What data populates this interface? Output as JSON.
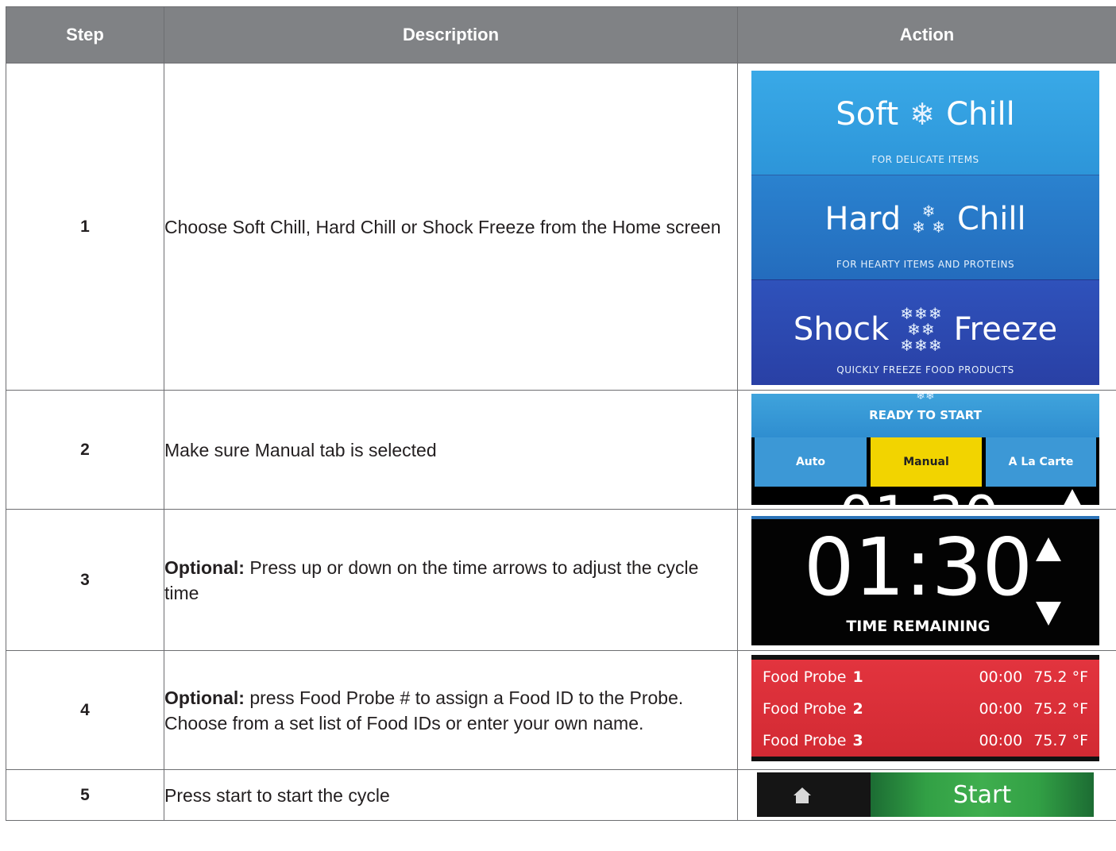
{
  "table": {
    "headers": {
      "step": "Step",
      "description": "Description",
      "action": "Action"
    },
    "rows": [
      {
        "step": "1",
        "description": "Choose Soft Chill, Hard Chill or Shock Freeze from the Home screen",
        "action": {
          "modes": [
            {
              "left": "Soft",
              "right": "Chill",
              "subtitle": "FOR DELICATE ITEMS"
            },
            {
              "left": "Hard",
              "right": "Chill",
              "subtitle": "FOR HEARTY ITEMS AND PROTEINS"
            },
            {
              "left": "Shock",
              "right": "Freeze",
              "subtitle": "QUICKLY FREEZE FOOD PRODUCTS"
            }
          ]
        }
      },
      {
        "step": "2",
        "description": "Make sure Manual tab is selected",
        "action": {
          "status": "READY TO START",
          "tabs": [
            "Auto",
            "Manual",
            "A La Carte"
          ],
          "selected_tab": "Manual"
        }
      },
      {
        "step": "3",
        "description_bold": "Optional:",
        "description": "Press up or down on the time arrows to adjust the cycle time",
        "action": {
          "time": "01:30",
          "label": "TIME REMAINING"
        }
      },
      {
        "step": "4",
        "description_bold": "Optional:",
        "description": "press Food Probe # to assign a Food ID to the Probe. Choose from a set list of Food IDs or enter your own name.",
        "action": {
          "probes": [
            {
              "label": "Food Probe",
              "number": "1",
              "time": "00:00",
              "temp": "75.2 °F"
            },
            {
              "label": "Food Probe",
              "number": "2",
              "time": "00:00",
              "temp": "75.2 °F"
            },
            {
              "label": "Food Probe",
              "number": "3",
              "time": "00:00",
              "temp": "75.7 °F"
            }
          ]
        }
      },
      {
        "step": "5",
        "description": "Press start to start the cycle",
        "action": {
          "start_label": "Start",
          "home_icon": "home-icon"
        }
      }
    ]
  },
  "colors": {
    "header_bg": "#808285",
    "soft_chill": "#39a9e7",
    "hard_chill": "#2a82cf",
    "shock_freeze": "#2f52bb",
    "manual_tab": "#f2d400",
    "probe_red": "#e2343e",
    "start_green": "#3fae4e"
  }
}
